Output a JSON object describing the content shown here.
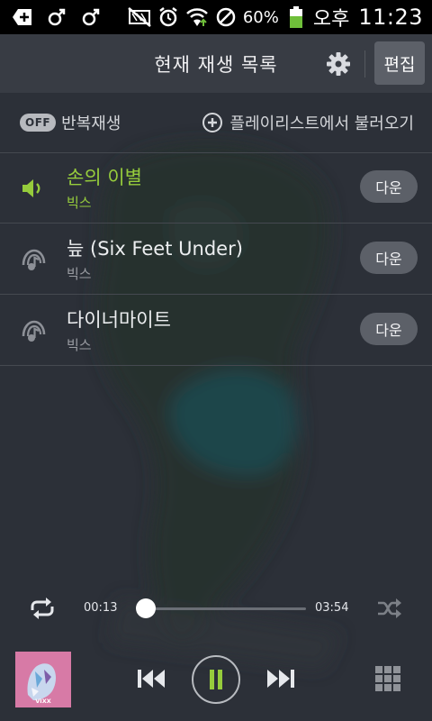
{
  "status_bar": {
    "battery_percent": "60%",
    "ampm": "오후",
    "time": "11:23",
    "icons": [
      "add-icon",
      "gender-icon",
      "gender-icon",
      "mute-icon",
      "alarm-icon",
      "wifi-icon",
      "no-sync-icon",
      "battery-icon"
    ]
  },
  "header": {
    "title": "현재 재생 목록",
    "edit_label": "편집"
  },
  "toolbar": {
    "repeat_toggle_state": "OFF",
    "repeat_label": "반복재생",
    "load_playlist_label": "플레이리스트에서 불러오기"
  },
  "tracks": [
    {
      "title": "손의 이별",
      "artist": "빅스",
      "action_label": "다운",
      "playing": true
    },
    {
      "title": "늪 (Six Feet Under)",
      "artist": "빅스",
      "action_label": "다운",
      "playing": false
    },
    {
      "title": "다이너마이트",
      "artist": "빅스",
      "action_label": "다운",
      "playing": false
    }
  ],
  "player": {
    "current_time": "00:13",
    "total_time": "03:54",
    "progress_fraction": 0.055,
    "album_label": "VIXX"
  },
  "colors": {
    "accent_green": "#96cc3c",
    "background": "#2c3038",
    "header_bg": "#383c44",
    "button_bg": "#5c6068"
  }
}
